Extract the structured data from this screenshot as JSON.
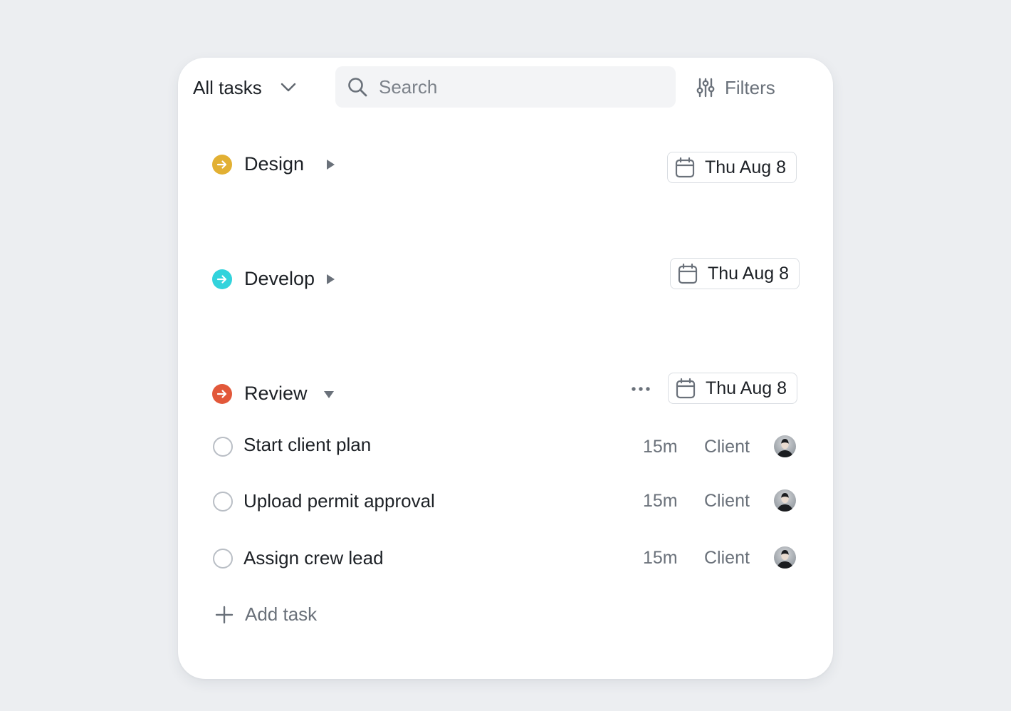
{
  "header": {
    "scope_label": "All tasks",
    "search_placeholder": "Search",
    "filters_label": "Filters"
  },
  "sections": [
    {
      "title": "Design",
      "date": "Thu Aug 8",
      "color": "#e2b033",
      "expanded": false
    },
    {
      "title": "Develop",
      "date": "Thu Aug 8",
      "color": "#32d3dc",
      "expanded": false
    },
    {
      "title": "Review",
      "date": "Thu Aug 8",
      "color": "#e2583a",
      "expanded": true
    }
  ],
  "tasks": [
    {
      "title": "Start client plan",
      "duration": "15m",
      "tag": "Client",
      "avatar": "avatar"
    },
    {
      "title": "Upload permit approval",
      "duration": "15m",
      "tag": "Client",
      "avatar": "avatar"
    },
    {
      "title": "Assign crew lead",
      "duration": "15m",
      "tag": "Client",
      "avatar": "avatar"
    }
  ],
  "add_task_label": "Add task"
}
